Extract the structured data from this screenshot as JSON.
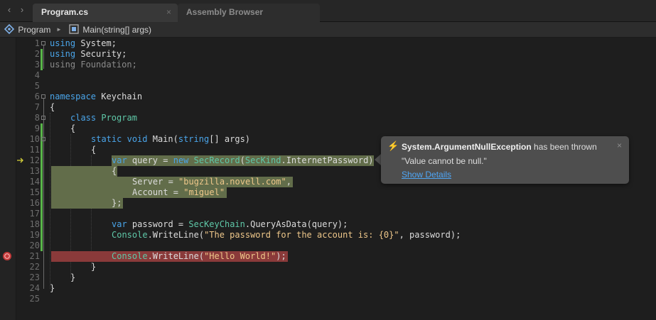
{
  "tabs": [
    {
      "label": "Program.cs",
      "active": true
    },
    {
      "label": "Assembly Browser",
      "active": false
    }
  ],
  "breadcrumb": {
    "item1": "Program",
    "separator": "►",
    "item2": "Main(string[] args)"
  },
  "editor": {
    "line_numbers": [
      "1",
      "2",
      "3",
      "4",
      "5",
      "6",
      "7",
      "8",
      "9",
      "10",
      "11",
      "12",
      "13",
      "14",
      "15",
      "16",
      "17",
      "18",
      "19",
      "20",
      "21",
      "22",
      "23",
      "24",
      "25"
    ],
    "code": {
      "l1_kw": "using",
      "l1_rest": " System;",
      "l2_kw": "using",
      "l2_rest": " Security;",
      "l3": "using Foundation;",
      "l6_kw": "namespace",
      "l6_rest": " Keychain",
      "l7": "{",
      "l8_kw": "class",
      "l8_ty": "Program",
      "l9": "{",
      "l10_kw1": "static",
      "l10_kw2": "void",
      "l10_name": " Main(",
      "l10_kw3": "string",
      "l10_rest": "[] args)",
      "l11": "{",
      "l12_kw1": "var",
      "l12_a": " query = ",
      "l12_kw2": "new",
      "l12_ty1": "SecRecord",
      "l12_b": "(",
      "l12_ty2": "SecKind",
      "l12_c": ".InternetPassword)",
      "l13": "{",
      "l14_a": "Server = ",
      "l14_str": "\"bugzilla.novell.com\"",
      "l14_b": ",",
      "l15_a": "Account = ",
      "l15_str": "\"miguel\"",
      "l16": "};",
      "l18_kw": "var",
      "l18_a": " password = ",
      "l18_ty": "SecKeyChain",
      "l18_b": ".QueryAsData(query);",
      "l19_ty": "Console",
      "l19_a": ".WriteLine(",
      "l19_str": "\"The password for the account is: {0}\"",
      "l19_b": ", password);",
      "l21_ty": "Console",
      "l21_a": ".WriteLine(",
      "l21_str": "\"Hello World!\"",
      "l21_b": ");",
      "l22": "}",
      "l23": "}",
      "l24": "}"
    }
  },
  "exception_popup": {
    "exception_type": "System.ArgumentNullException",
    "thrown_text": " has been thrown",
    "message": "\"Value cannot be null.\"",
    "link": "Show Details",
    "close": "×",
    "bolt": "⚡"
  },
  "icons": {
    "back": "‹",
    "forward": "›",
    "tab_close": "×"
  },
  "colors": {
    "keyword": "#4aa5ea",
    "type": "#5fc8a8",
    "string": "#eec78a",
    "exec_highlight": "#626d4a",
    "breakpoint_highlight": "#8a3a3a",
    "change_bar": "#59b54a",
    "link": "#4ea6f5"
  }
}
